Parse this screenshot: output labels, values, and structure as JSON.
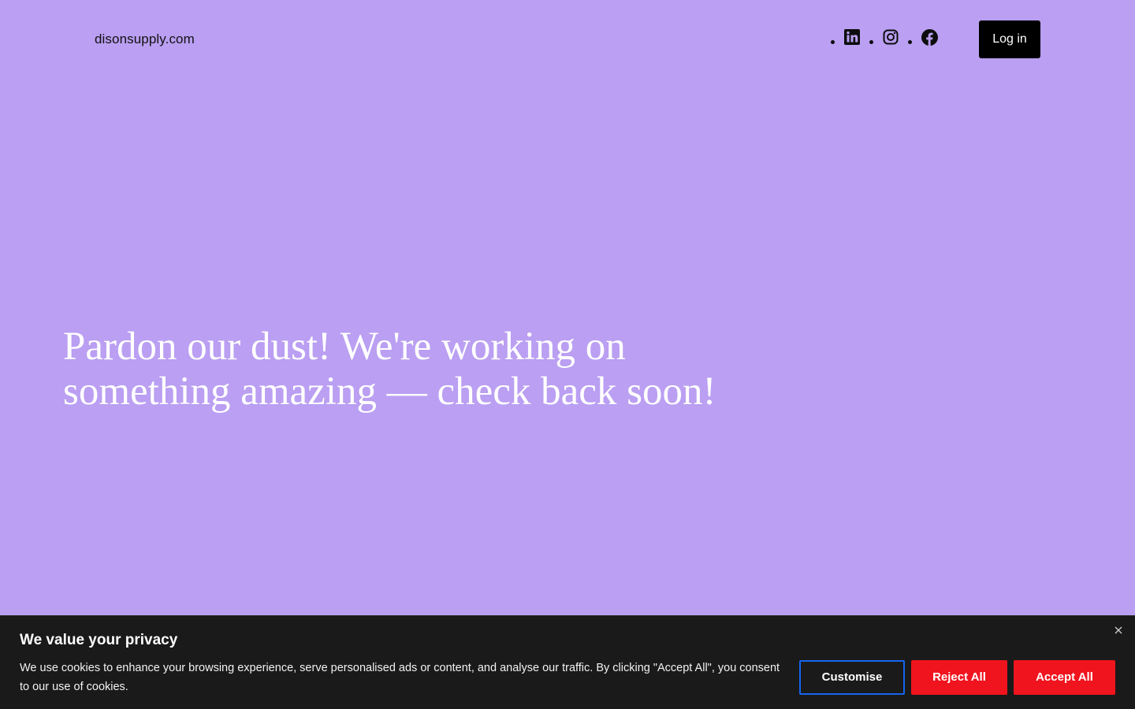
{
  "header": {
    "site_name": "disonsupply.com",
    "social_icons": [
      "linkedin-icon",
      "instagram-icon",
      "facebook-icon"
    ],
    "login_label": "Log in"
  },
  "hero": {
    "headline": "Pardon our dust! We're working on something amazing — check back soon!"
  },
  "cookie_banner": {
    "title": "We value your privacy",
    "text": "We use cookies to enhance your browsing experience, serve personalised ads or content, and analyse our traffic. By clicking \"Accept All\", you consent to our use of cookies.",
    "customise_label": "Customise",
    "reject_label": "Reject All",
    "accept_label": "Accept All"
  },
  "colors": {
    "page_background": "#BA9FF2",
    "banner_background": "#1A1A1A",
    "accent_red": "#F0141E",
    "accent_blue": "#1565F0"
  }
}
